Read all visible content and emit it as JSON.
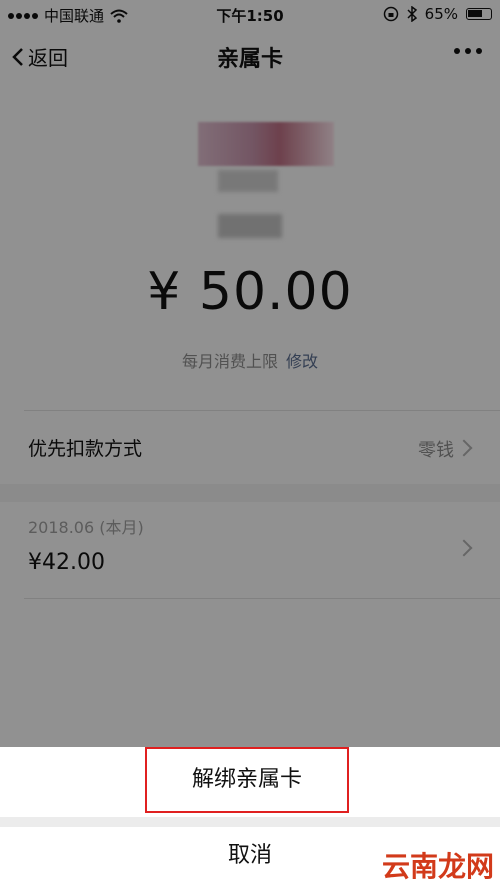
{
  "statusbar": {
    "carrier": "中国联通",
    "time": "下午1:50",
    "battery": "65%"
  },
  "navbar": {
    "back_label": "返回",
    "title": "亲属卡"
  },
  "card": {
    "amount": "¥ 50.00",
    "limit_label": "每月消费上限",
    "edit_label": "修改"
  },
  "payment": {
    "label": "优先扣款方式",
    "value": "零钱"
  },
  "month": {
    "date": "2018.06 (本月)",
    "spent": "¥42.00"
  },
  "sheet": {
    "unbind_label": "解绑亲属卡",
    "cancel_label": "取消"
  },
  "watermark": "云南龙网",
  "colors": {
    "highlight": "#e02020",
    "link": "#57698a"
  }
}
